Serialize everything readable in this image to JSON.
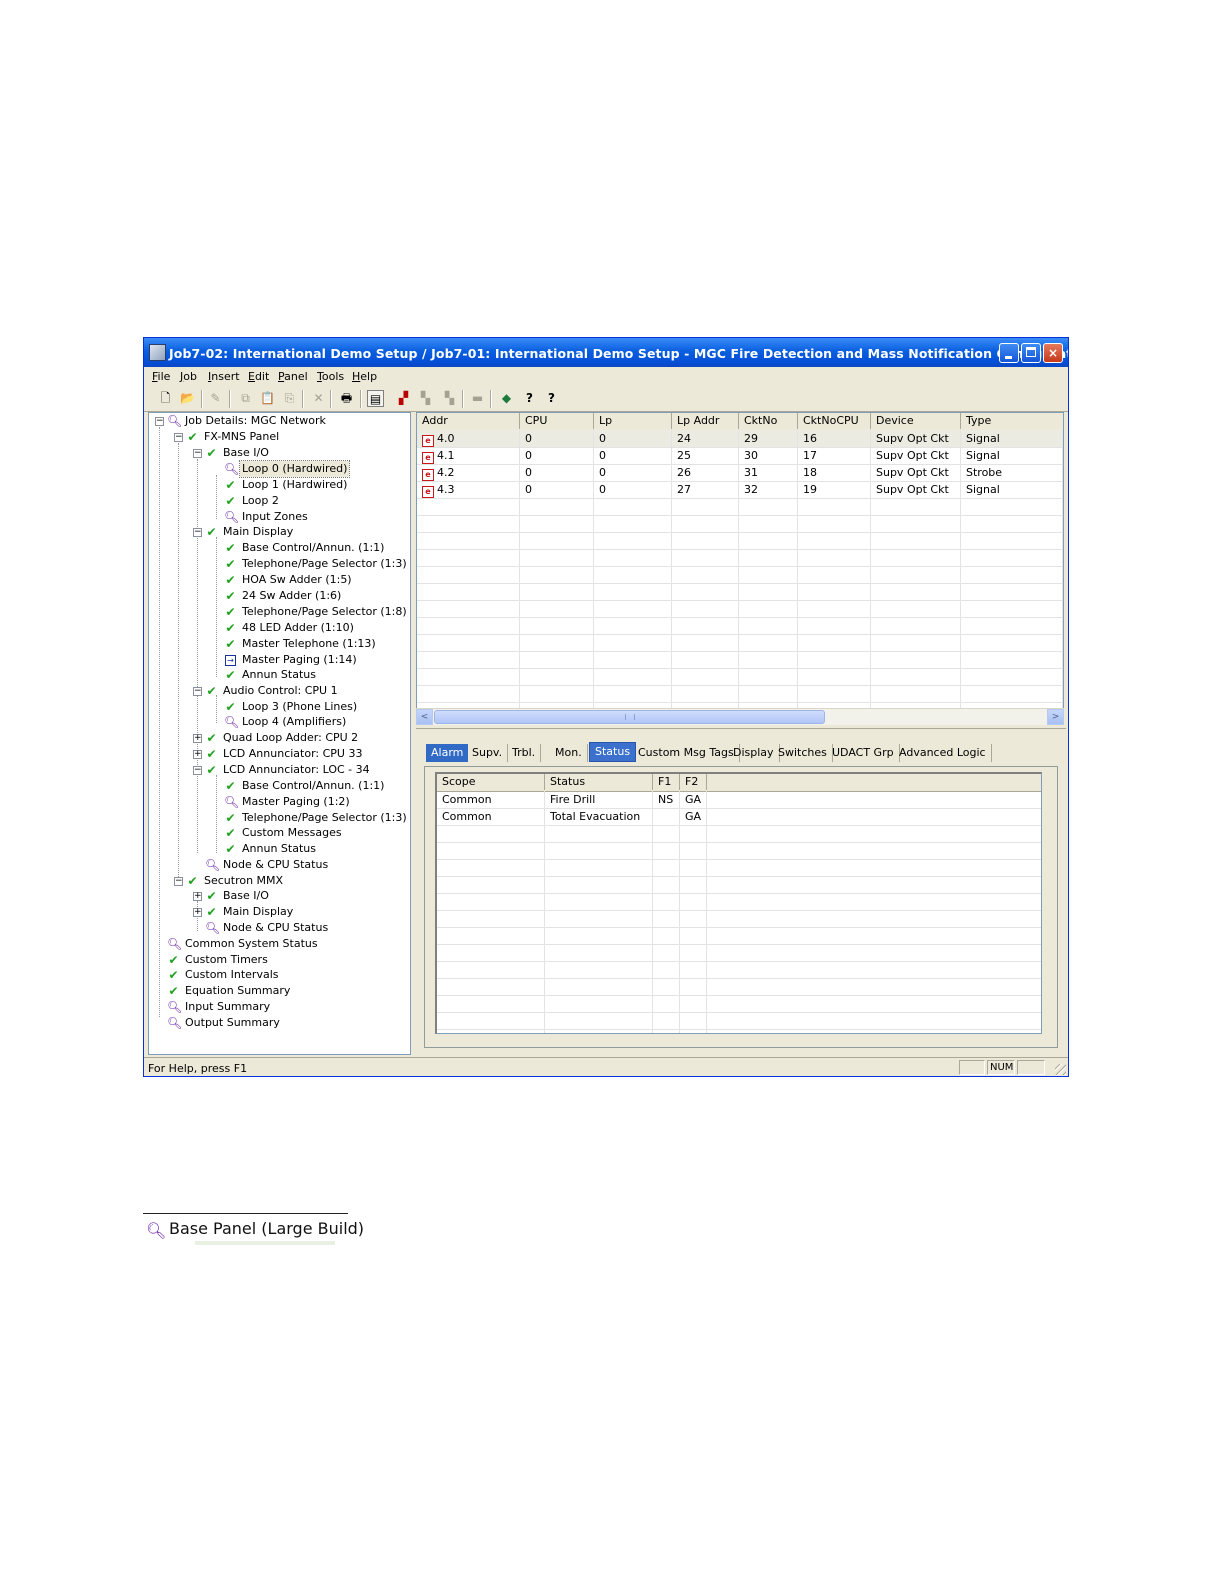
{
  "window": {
    "title": "Job7-02: International Demo Setup / Job7-01: International Demo Setup - MGC Fire Detection and Mass Notification Configurator",
    "titlebar_color": "#0a5fe0",
    "buttons": {
      "minimize": "minimize-icon",
      "maximize": "maximize-icon",
      "close": "×"
    }
  },
  "menu": [
    "File",
    "Job",
    "Insert",
    "Edit",
    "Panel",
    "Tools",
    "Help"
  ],
  "toolbar": {
    "new": "🗋",
    "open": "📂",
    "pen": "✎",
    "copy": "⧉",
    "paste": "📋",
    "paste2": "⎘",
    "delete": "✕",
    "print": "🖶",
    "props": "▤",
    "net1": "▞",
    "net2": "▚",
    "net3": "▚",
    "book": "▬",
    "globe": "◆",
    "help": "?",
    "whatsthis": "?"
  },
  "tree": [
    {
      "label": "Job Details: MGC Network"
    },
    {
      "label": "FX-MNS Panel"
    },
    {
      "label": "Base I/O"
    },
    {
      "label": "Loop 0  (Hardwired)"
    },
    {
      "label": "Loop 1  (Hardwired)"
    },
    {
      "label": "Loop 2"
    },
    {
      "label": "Input Zones"
    },
    {
      "label": "Main Display"
    },
    {
      "label": "Base Control/Annun. (1:1)"
    },
    {
      "label": "Telephone/Page Selector (1:3)"
    },
    {
      "label": "HOA Sw Adder (1:5)"
    },
    {
      "label": "24 Sw Adder (1:6)"
    },
    {
      "label": "Telephone/Page Selector (1:8)"
    },
    {
      "label": "48 LED Adder (1:10)"
    },
    {
      "label": "Master Telephone (1:13)"
    },
    {
      "label": "Master Paging (1:14)"
    },
    {
      "label": "Annun Status"
    },
    {
      "label": "Audio Control: CPU 1"
    },
    {
      "label": "Loop 3  (Phone Lines)"
    },
    {
      "label": "Loop 4  (Amplifiers)"
    },
    {
      "label": "Quad Loop Adder: CPU 2"
    },
    {
      "label": "LCD Annunciator: CPU 33"
    },
    {
      "label": "LCD Annunciator: LOC - 34"
    },
    {
      "label": "Base Control/Annun. (1:1)"
    },
    {
      "label": "Master Paging (1:2)"
    },
    {
      "label": "Telephone/Page Selector (1:3)"
    },
    {
      "label": "Custom Messages"
    },
    {
      "label": "Annun Status"
    },
    {
      "label": "Node & CPU Status"
    },
    {
      "label": "Secutron MMX"
    },
    {
      "label": "Base I/O"
    },
    {
      "label": "Main Display"
    },
    {
      "label": "Node & CPU Status"
    },
    {
      "label": "Common System Status"
    },
    {
      "label": "Custom Timers"
    },
    {
      "label": "Custom Intervals"
    },
    {
      "label": "Equation Summary"
    },
    {
      "label": "Input Summary"
    },
    {
      "label": "Output Summary"
    }
  ],
  "tree_glyphs": {
    "plus": "+",
    "minus": "−",
    "check": "✔",
    "magnifier": "🔍︎",
    "output": "→"
  },
  "device_table": {
    "columns": [
      "Addr",
      "CPU",
      "Lp",
      "Lp Addr",
      "CktNo",
      "CktNoCPU",
      "Device",
      "Type"
    ],
    "rows": [
      [
        "4.0",
        "0",
        "0",
        "24",
        "29",
        "16",
        "Supv Opt Ckt",
        "Signal"
      ],
      [
        "4.1",
        "0",
        "0",
        "25",
        "30",
        "17",
        "Supv Opt Ckt",
        "Signal"
      ],
      [
        "4.2",
        "0",
        "0",
        "26",
        "31",
        "18",
        "Supv Opt Ckt",
        "Strobe"
      ],
      [
        "4.3",
        "0",
        "0",
        "27",
        "32",
        "19",
        "Supv Opt Ckt",
        "Signal"
      ]
    ],
    "device_icon": "e",
    "scroll": {
      "left": "<",
      "right": ">"
    }
  },
  "tabs": [
    "Alarm",
    "Supv.",
    "Trbl.",
    "Mon.",
    "Status",
    "Custom Msg Tags",
    "Display",
    "Switches",
    "UDACT Grp",
    "Advanced Logic"
  ],
  "active_tab": "Status",
  "status_table": {
    "columns": [
      "Scope",
      "Status",
      "F1",
      "F2"
    ],
    "rows": [
      [
        "Common",
        "Fire Drill",
        "NS",
        "GA"
      ],
      [
        "Common",
        "Total Evacuation",
        "",
        "GA"
      ]
    ]
  },
  "statusbar": {
    "help": "For Help, press F1",
    "num": "NUM"
  },
  "snippet": {
    "label": "Base Panel (Large Build)",
    "icon": "🔍︎"
  }
}
